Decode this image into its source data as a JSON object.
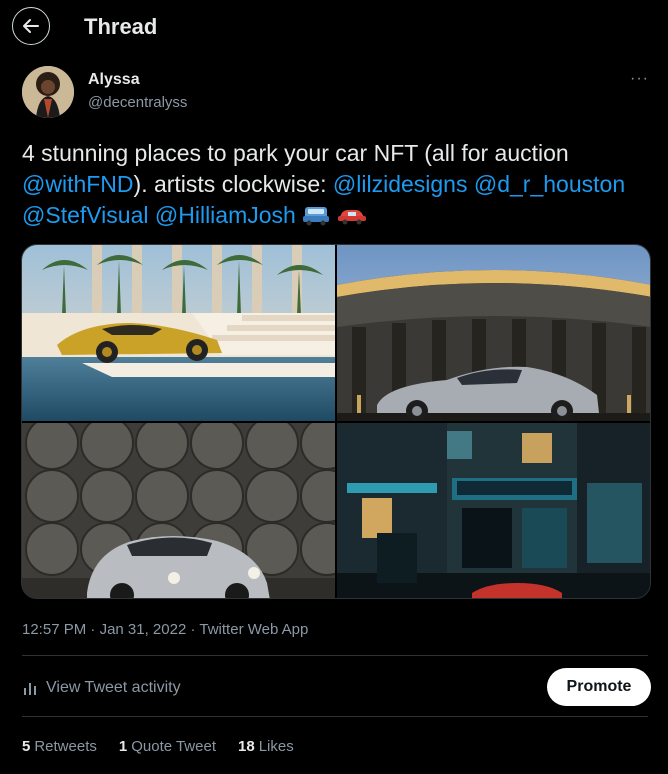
{
  "header": {
    "title": "Thread",
    "back_icon": "arrow-left-icon"
  },
  "author": {
    "name": "Alyssa",
    "handle": "@decentralyss",
    "more_icon": "more-horizontal-icon"
  },
  "tweet": {
    "text_part1": "4 stunning places to park your car NFT (all for auction ",
    "mention_fnd": "@withFND",
    "text_part2": "). artists clockwise: ",
    "mention_1": "@lilzidesigns",
    "mention_2": "@d_r_houston",
    "mention_3": "@StefVisual",
    "mention_4": "@HilliamJosh",
    "emojis": [
      "blue-car-icon",
      "red-car-icon"
    ]
  },
  "media": [
    {
      "description_icon": "image-gold-car-pool"
    },
    {
      "description_icon": "image-silver-car-arena"
    },
    {
      "description_icon": "image-porsche-barrels"
    },
    {
      "description_icon": "image-city-storefront"
    }
  ],
  "meta": {
    "time": "12:57 PM",
    "date": "Jan 31, 2022",
    "source": "Twitter Web App",
    "separator": "·"
  },
  "activity": {
    "label": "View Tweet activity",
    "icon": "bar-chart-icon"
  },
  "promote_label": "Promote",
  "stats": {
    "retweets_count": "5",
    "retweets_label": "Retweets",
    "quotes_count": "1",
    "quotes_label": "Quote Tweet",
    "likes_count": "18",
    "likes_label": "Likes"
  },
  "colors": {
    "background": "#000000",
    "text": "#e7e9ea",
    "muted": "#8b98a5",
    "link": "#1d9bf0",
    "divider": "#2f3336"
  }
}
